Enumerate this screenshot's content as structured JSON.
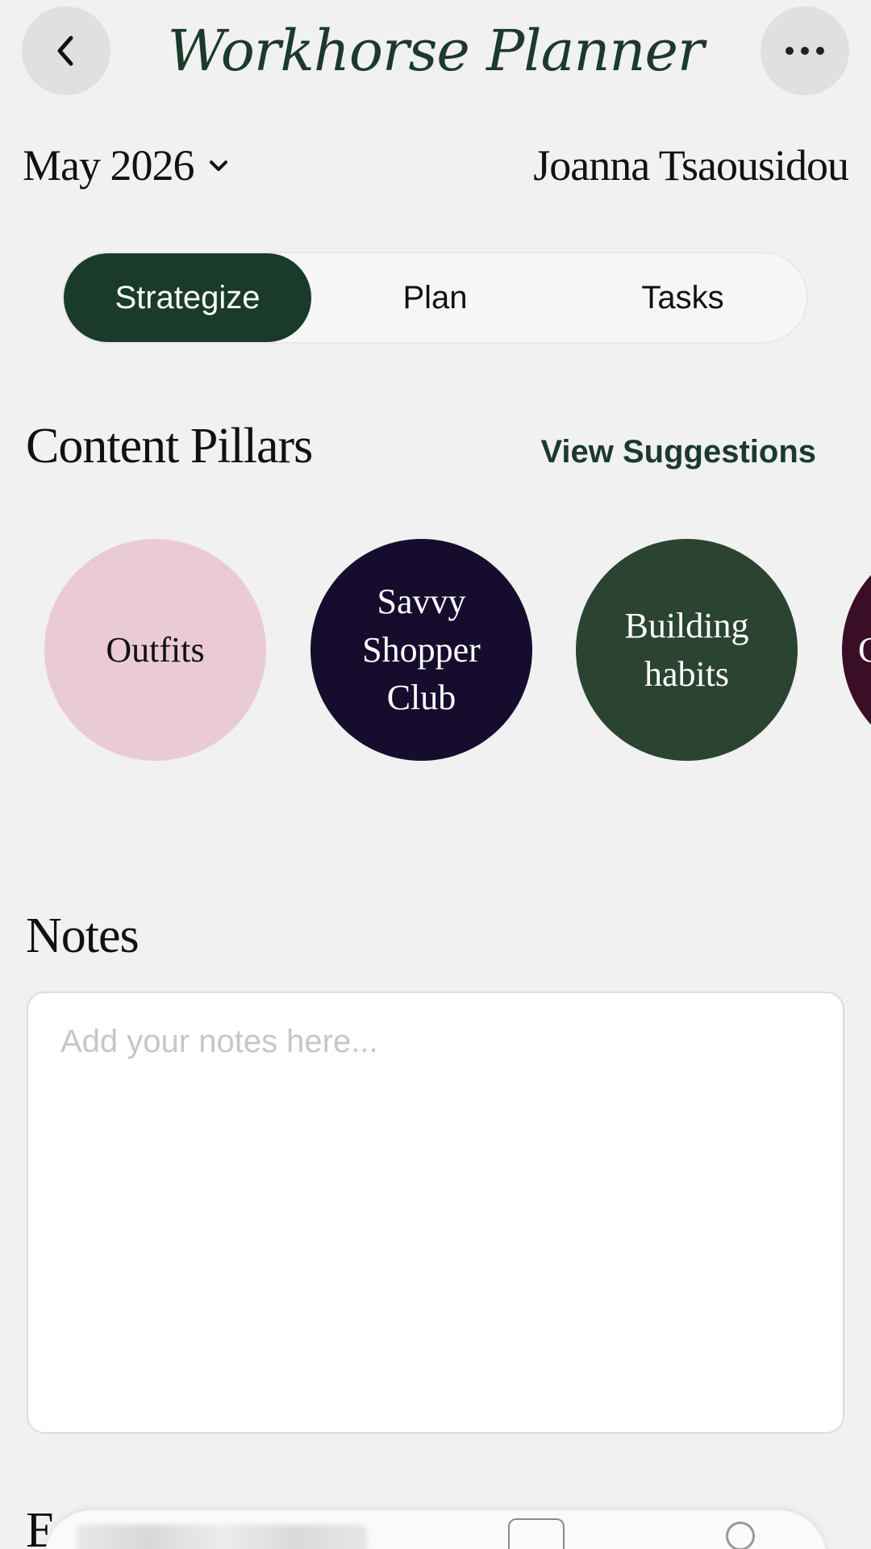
{
  "header": {
    "title": "Workhorse Planner",
    "back_icon": "chevron-left-icon",
    "more_icon": "ellipsis-icon"
  },
  "month_picker": {
    "label": "May 2026",
    "icon": "chevron-down-icon"
  },
  "user": {
    "name": "Joanna Tsaousidou"
  },
  "tabs": [
    {
      "label": "Strategize",
      "active": true
    },
    {
      "label": "Plan",
      "active": false
    },
    {
      "label": "Tasks",
      "active": false
    }
  ],
  "pillars_section": {
    "title": "Content Pillars",
    "link_label": "View Suggestions",
    "items": [
      {
        "label": "Outfits",
        "bg": "#ebcad8",
        "fg": "#111111"
      },
      {
        "label": "Savvy Shopper Club",
        "bg": "#160d2e",
        "fg": "#ffffff"
      },
      {
        "label": "Building habits",
        "bg": "#2b4432",
        "fg": "#ffffff"
      },
      {
        "label": "C",
        "bg": "#3a0f26",
        "fg": "#ffffff"
      }
    ]
  },
  "notes_section": {
    "title": "Notes",
    "placeholder": "Add your notes here...",
    "value": ""
  },
  "bottom_peek": {
    "title_fragment": "E"
  },
  "colors": {
    "accent": "#1a3a2a",
    "background": "#f1f1f1"
  }
}
